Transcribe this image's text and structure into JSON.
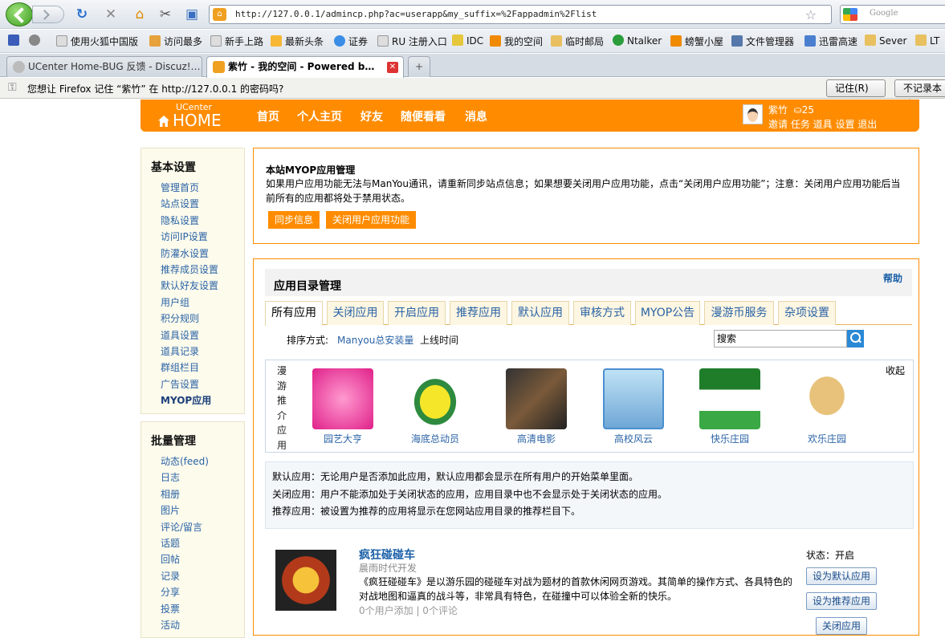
{
  "browser": {
    "url": "http://127.0.0.1/admincp.php?ac=userapp&my_suffix=%2Fappadmin%2Flist",
    "search_placeholder": "Google",
    "bookmarks": [
      "使用火狐中国版",
      "访问最多",
      "新手上路",
      "最新头条",
      "证券",
      "RU 注册入口",
      "IDC",
      "我的空间",
      "临时邮局",
      "Ntalker",
      "螃蟹小屋",
      "文件管理器",
      "迅雷高速",
      "Sever",
      "LT"
    ],
    "tabs": [
      {
        "title": "UCenter Home-BUG 反馈 - Discuz!…",
        "active": false
      },
      {
        "title": "紫竹 - 我的空间 - Powered b…",
        "active": true
      }
    ],
    "new_tab": "+",
    "password_prompt": "您想让 Firefox 记住 “紫竹” 在 http://127.0.0.1 的密码吗?",
    "remember_btn": "记住(R)",
    "never_btn": "不记录本站"
  },
  "header": {
    "logo_small": "UCenter",
    "logo_big": "HOME",
    "nav": [
      "首页",
      "个人主页",
      "好友",
      "随便看看",
      "消息"
    ],
    "user_name": "紫竹",
    "user_credit": "25",
    "user_links": "邀请 任务 道具 设置 退出"
  },
  "sidebar": {
    "group1_title": "基本设置",
    "group1": [
      "管理首页",
      "站点设置",
      "隐私设置",
      "访问IP设置",
      "防灌水设置",
      "推荐成员设置",
      "默认好友设置",
      "用户组",
      "积分规则",
      "道具设置",
      "道具记录",
      "群组栏目",
      "广告设置",
      "MYOP应用"
    ],
    "group2_title": "批量管理",
    "group2": [
      "动态(feed)",
      "日志",
      "相册",
      "图片",
      "评论/留言",
      "话题",
      "回帖",
      "记录",
      "分享",
      "投票",
      "活动"
    ]
  },
  "myop": {
    "title": "本站MYOP应用管理",
    "desc": "如果用户应用功能无法与ManYou通讯，请重新同步站点信息；如果想要关闭用户应用功能，点击“关闭用户应用功能”；注意：关闭用户应用功能后当前所有的应用都将处于禁用状态。",
    "sync_btn": "同步信息",
    "close_btn": "关闭用户应用功能"
  },
  "catalog": {
    "title": "应用目录管理",
    "help": "帮助",
    "tabs": [
      "所有应用",
      "关闭应用",
      "开启应用",
      "推荐应用",
      "默认应用",
      "审核方式",
      "MYOP公告",
      "漫游币服务",
      "杂项设置"
    ],
    "sort_label": "排序方式:",
    "sort_options": [
      "Manyou总安装量",
      "上线时间"
    ],
    "search_value": "搜索",
    "rec_label": "漫游推介应用",
    "collapse": "收起",
    "rec_apps": [
      "园艺大亨",
      "海底总动员",
      "高清电影",
      "高校风云",
      "快乐庄园",
      "欢乐庄园"
    ],
    "notes": [
      "默认应用：无论用户是否添加此应用，默认应用都会显示在所有用户的开始菜单里面。",
      "关闭应用：用户不能添加处于关闭状态的应用，应用目录中也不会显示处于关闭状态的应用。",
      "推荐应用：被设置为推荐的应用将显示在您网站应用目录的推荐栏目下。"
    ],
    "app": {
      "name": "疯狂碰碰车",
      "developer": "晨雨时代开发",
      "desc": "《疯狂碰碰车》是以游乐园的碰碰车对战为题材的首款休闲网页游戏。其简单的操作方式、各具特色的对战地图和逼真的战斗等，非常具有特色，在碰撞中可以体验全新的快乐。",
      "meta": "0个用户添加 | 0个评论",
      "state": "状态：开启",
      "btn_default": "设为默认应用",
      "btn_recommend": "设为推荐应用",
      "btn_close": "关闭应用"
    }
  }
}
